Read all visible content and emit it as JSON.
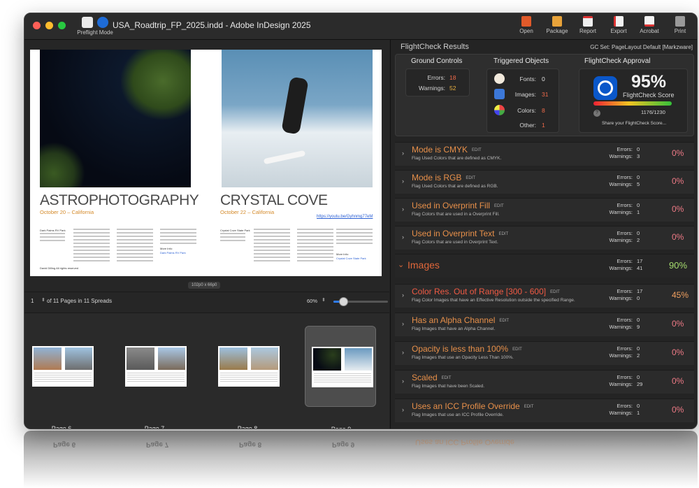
{
  "window": {
    "title": "USA_Roadtrip_FP_2025.indd - Adobe InDesign 2025",
    "preflight_label": "Preflight Mode"
  },
  "toolbar": {
    "open": "Open",
    "package": "Package",
    "report": "Report",
    "export": "Export",
    "acrobat": "Acrobat",
    "print": "Print"
  },
  "spread": {
    "left_title": "ASTROPHOTOGRAPHY",
    "left_date": "October 20 – California",
    "right_title": "CRYSTAL COVE",
    "right_date": "October 22 – California",
    "link": "https://youtu.be/Gyhnmg77eM",
    "left_address": "Dark Palms RV Park",
    "left_credit": "David Dilling All rights reserved",
    "right_address": "Crystal Cove State Park",
    "more_info": "More Info:",
    "left_more_link": "Dark Palms RV Park",
    "right_more_link": "Crystal Cove State Park",
    "size_badge": "102p0 x 66p0"
  },
  "pagebar": {
    "page": "1",
    "of_text": "of 11 Pages in 11 Spreads",
    "zoom": "60%",
    "zoom_value": 0.18
  },
  "thumbnails": [
    {
      "label": "Page 6",
      "selected": false
    },
    {
      "label": "Page 7",
      "selected": false
    },
    {
      "label": "Page 8",
      "selected": false
    },
    {
      "label": "Page 9",
      "selected": true
    }
  ],
  "flightcheck": {
    "header": "FlightCheck Results",
    "gc_set": "GC Set: PageLayout Default [Markzware]",
    "ground": {
      "title": "Ground Controls",
      "errors_label": "Errors:",
      "errors": "18",
      "warnings_label": "Warnings:",
      "warnings": "52"
    },
    "triggered": {
      "title": "Triggered Objects",
      "fonts_label": "Fonts:",
      "fonts": "0",
      "images_label": "Images:",
      "images": "31",
      "colors_label": "Colors:",
      "colors": "8",
      "other_label": "Other:",
      "other": "1"
    },
    "approval": {
      "title": "FlightCheck Approval",
      "score": "95%",
      "score_label": "FlightCheck Score",
      "ratio": "1176/1230",
      "help": "?",
      "share": "Share your FlightCheck Score..."
    }
  },
  "results": {
    "edit": "EDIT",
    "errors_label": "Errors:",
    "warnings_label": "Warnings:",
    "rows": [
      {
        "title": "Mode is CMYK",
        "desc": "Flag Used Colors that are defined as CMYK.",
        "errors": "0",
        "warnings": "3",
        "pct": "0%"
      },
      {
        "title": "Mode is RGB",
        "desc": "Flag Used Colors that are defined as RGB.",
        "errors": "0",
        "warnings": "5",
        "pct": "0%"
      },
      {
        "title": "Used in Overprint Fill",
        "desc": "Flag Colors that are used in a Overprint Fill.",
        "errors": "0",
        "warnings": "1",
        "pct": "0%"
      },
      {
        "title": "Used in Overprint Text",
        "desc": "Flag Colors that are used in Overprint Text.",
        "errors": "0",
        "warnings": "2",
        "pct": "0%"
      }
    ],
    "category": {
      "title": "Images",
      "errors": "17",
      "warnings": "41",
      "pct": "90%"
    },
    "image_rows": [
      {
        "title": "Color Res. Out of Range [300 - 600]",
        "desc": "Flag Color Images that have an Effective Resolution outside the specified Range.",
        "errors": "17",
        "warnings": "0",
        "pct": "45%"
      },
      {
        "title": "Has an Alpha Channel",
        "desc": "Flag Images that have an Alpha Channel.",
        "errors": "0",
        "warnings": "9",
        "pct": "0%"
      },
      {
        "title": "Opacity is less than 100%",
        "desc": "Flag Images that use an Opacity Less Than 100%.",
        "errors": "0",
        "warnings": "2",
        "pct": "0%"
      },
      {
        "title": "Scaled",
        "desc": "Flag Images that have been Scaled.",
        "errors": "0",
        "warnings": "29",
        "pct": "0%"
      },
      {
        "title": "Uses an ICC Profile Override",
        "desc": "Flag Images that use an ICC Profile Override.",
        "errors": "0",
        "warnings": "1",
        "pct": "0%"
      }
    ]
  }
}
